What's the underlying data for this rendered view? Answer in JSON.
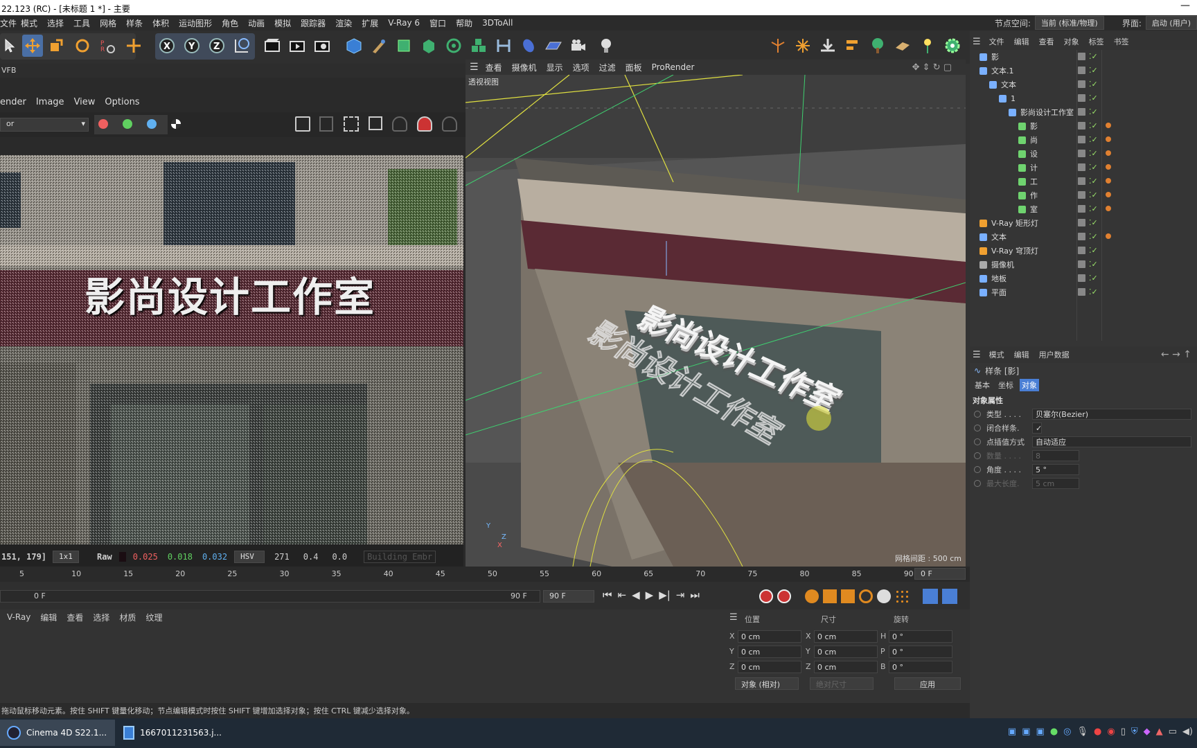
{
  "window": {
    "title": "22.123 (RC) - [未标题 1 *] - 主要",
    "minimize": "—"
  },
  "menu": [
    "模式",
    "选择",
    "工具",
    "网格",
    "样条",
    "体积",
    "运动图形",
    "角色",
    "动画",
    "模拟",
    "跟踪器",
    "渲染",
    "扩展",
    "V-Ray 6",
    "窗口",
    "帮助",
    "3DToAll"
  ],
  "menu_first": "文件",
  "node_space": {
    "label": "节点空间:",
    "value": "当前 (标准/物理)"
  },
  "interface": {
    "label": "界面:",
    "value": "启动 (用户)"
  },
  "vfb": {
    "title": "VFB",
    "menus": [
      "ender",
      "Image",
      "View",
      "Options"
    ],
    "channel": "or",
    "status": {
      "coords": "151, 179]",
      "zoom": "1x1",
      "mode": "Raw",
      "r": "0.025",
      "g": "0.018",
      "b": "0.032",
      "space": "HSV",
      "h": "271",
      "s": "0.4",
      "v": "0.0",
      "embree": "Building Embr"
    },
    "sign_text": "影尚设计工作室"
  },
  "viewport": {
    "menus": [
      "查看",
      "摄像机",
      "显示",
      "选项",
      "过滤",
      "面板",
      "ProRender"
    ],
    "label": "透视视图",
    "grid": "网格间距 : 500 cm",
    "text3d": "影尚设计工作室",
    "axes": {
      "y": "Y",
      "z": "Z",
      "x": "X"
    }
  },
  "timeline": {
    "ticks": [
      "5",
      "10",
      "15",
      "20",
      "25",
      "30",
      "35",
      "40",
      "45",
      "50",
      "55",
      "60",
      "65",
      "70",
      "75",
      "80",
      "85",
      "90"
    ],
    "current": "0 F",
    "start": "0 F",
    "end": "90 F",
    "end2": "90 F"
  },
  "material_menu": [
    "V-Ray",
    "编辑",
    "查看",
    "选择",
    "材质",
    "纹理"
  ],
  "coord": {
    "headers": [
      "位置",
      "尺寸",
      "旋转"
    ],
    "rows": [
      {
        "a": "X",
        "av": "0 cm",
        "b": "X",
        "bv": "0 cm",
        "c": "H",
        "cv": "0 °"
      },
      {
        "a": "Y",
        "av": "0 cm",
        "b": "Y",
        "bv": "0 cm",
        "c": "P",
        "cv": "0 °"
      },
      {
        "a": "Z",
        "av": "0 cm",
        "b": "Z",
        "bv": "0 cm",
        "c": "B",
        "cv": "0 °"
      }
    ],
    "mode": "对象 (相对)",
    "size_mode": "绝对尺寸",
    "apply": "应用"
  },
  "status": "拖动鼠标移动元素。按住 SHIFT 键量化移动；节点编辑模式时按住 SHIFT 键增加选择对象；按住 CTRL 键减少选择对象。",
  "taskbar": {
    "app1": "Cinema 4D S22.1...",
    "app2": "1667011231563.j..."
  },
  "objmgr": {
    "menu": [
      "文件",
      "编辑",
      "查看",
      "对象",
      "标签",
      "书签"
    ],
    "items": [
      {
        "name": "影",
        "indent": 0,
        "color": "#7ab0ff"
      },
      {
        "name": "文本.1",
        "indent": 0,
        "color": "#7ab0ff"
      },
      {
        "name": "文本",
        "indent": 1,
        "color": "#7ab0ff"
      },
      {
        "name": "1",
        "indent": 2,
        "color": "#7ab0ff"
      },
      {
        "name": "影尚设计工作室",
        "indent": 3,
        "color": "#7ab0ff"
      },
      {
        "name": "影",
        "indent": 4,
        "color": "#6fd36f"
      },
      {
        "name": "尚",
        "indent": 4,
        "color": "#6fd36f"
      },
      {
        "name": "设",
        "indent": 4,
        "color": "#6fd36f"
      },
      {
        "name": "计",
        "indent": 4,
        "color": "#6fd36f"
      },
      {
        "name": "工",
        "indent": 4,
        "color": "#6fd36f"
      },
      {
        "name": "作",
        "indent": 4,
        "color": "#6fd36f"
      },
      {
        "name": "室",
        "indent": 4,
        "color": "#6fd36f"
      },
      {
        "name": "V-Ray 矩形灯",
        "indent": 0,
        "color": "#f0a030"
      },
      {
        "name": "文本",
        "indent": 0,
        "color": "#7ab0ff"
      },
      {
        "name": "V-Ray 穹顶灯",
        "indent": 0,
        "color": "#f0a030"
      },
      {
        "name": "摄像机",
        "indent": 0,
        "color": "#aaaaaa"
      },
      {
        "name": "地板",
        "indent": 0,
        "color": "#7ab0ff"
      },
      {
        "name": "平面",
        "indent": 0,
        "color": "#7ab0ff"
      }
    ]
  },
  "attr": {
    "menu": [
      "模式",
      "编辑",
      "用户数据"
    ],
    "object": "样条 [影]",
    "tabs": [
      "基本",
      "坐标",
      "对象"
    ],
    "section": "对象属性",
    "props": [
      {
        "label": "类型 . . . .",
        "value": "贝塞尔(Bezier)"
      },
      {
        "label": "闭合样条.",
        "value": "✓"
      },
      {
        "label": "点插值方式",
        "value": "自动适应"
      },
      {
        "label": "数量 . . . .",
        "value": "8"
      },
      {
        "label": "角度 . . . .",
        "value": "5 °"
      },
      {
        "label": "最大长度.",
        "value": "5 cm"
      }
    ]
  }
}
